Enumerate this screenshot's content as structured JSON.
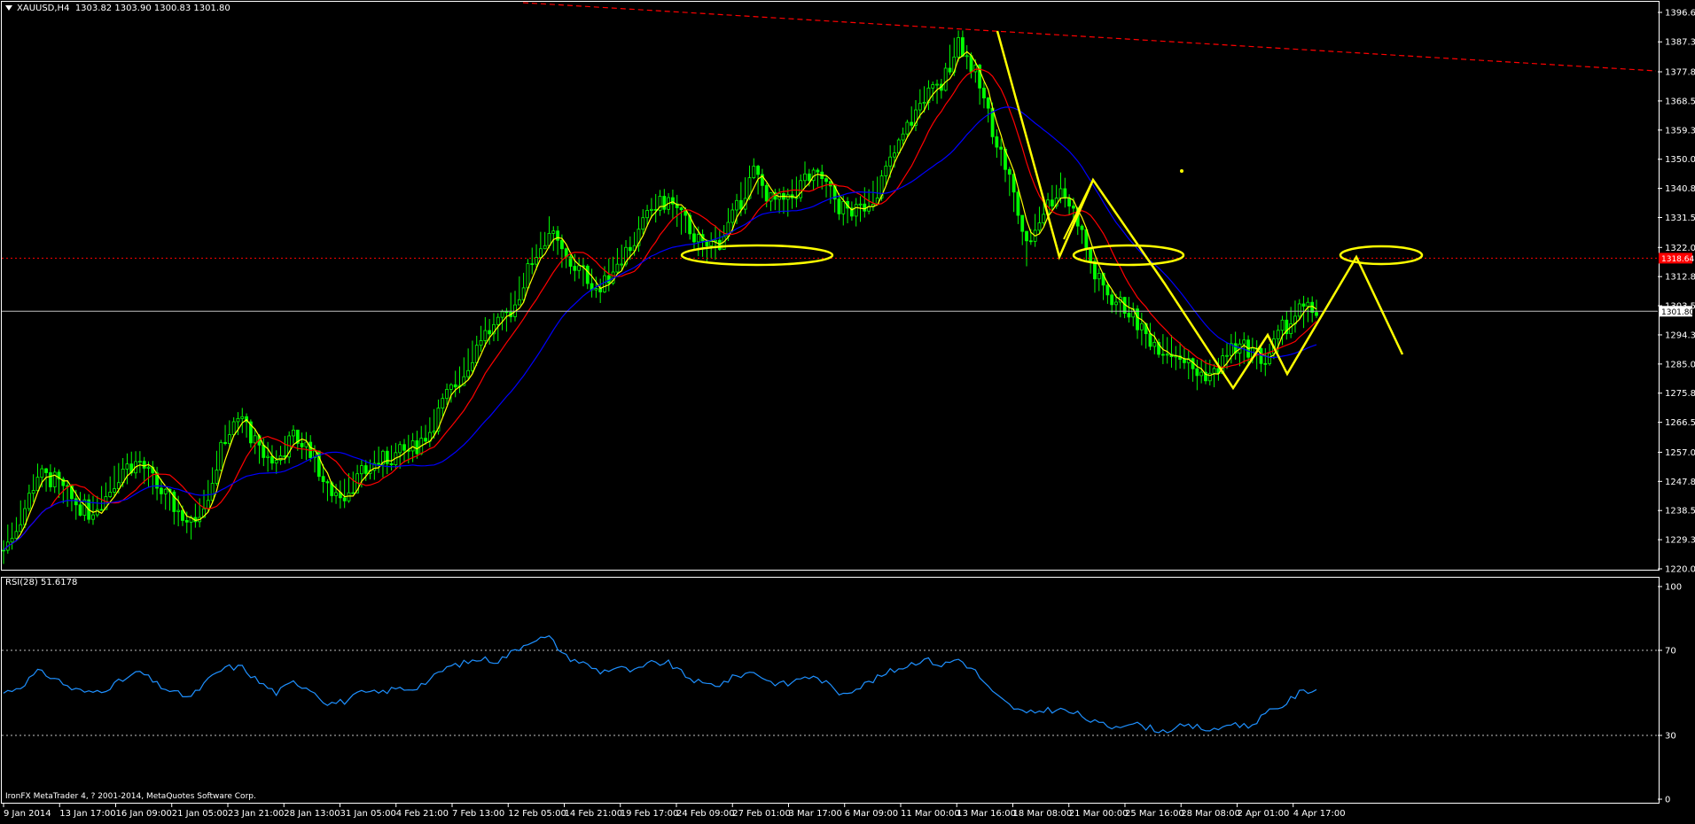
{
  "header": {
    "symbol": "XAUUSD,H4",
    "ohlc": "1303.82 1303.90 1300.83 1301.80"
  },
  "rsi_header": "RSI(28) 51.6178",
  "copyright": "IronFX MetaTrader 4, ? 2001-2014, MetaQuotes Software Corp.",
  "colors": {
    "background": "#000000",
    "candles": "#00ff00",
    "ma_fast": "#ffff00",
    "ma_mid": "#ff0000",
    "ma_slow": "#0000ff",
    "rsi_line": "#1e90ff",
    "annotation": "#ffff00",
    "resistance": "#ff0000",
    "current_price_line": "#c0c0c0"
  },
  "chart_data": [
    {
      "type": "line",
      "subtype": "candlestick",
      "symbol": "XAUUSD",
      "timeframe": "H4",
      "y_ticks": [
        "1396.65",
        "1387.30",
        "1377.80",
        "1368.55",
        "1359.30",
        "1350.05",
        "1340.80",
        "1331.55",
        "1322.05",
        "1312.80",
        "1303.55",
        "1294.30",
        "1285.05",
        "1275.80",
        "1266.55",
        "1257.05",
        "1247.80",
        "1238.55",
        "1229.30",
        "1220.05"
      ],
      "ylim": [
        1220.05,
        1396.65
      ],
      "x_ticks": [
        "9 Jan 2014",
        "13 Jan 17:00",
        "16 Jan 09:00",
        "21 Jan 05:00",
        "23 Jan 21:00",
        "28 Jan 13:00",
        "31 Jan 05:00",
        "4 Feb 21:00",
        "7 Feb 13:00",
        "12 Feb 05:00",
        "14 Feb 21:00",
        "19 Feb 17:00",
        "24 Feb 09:00",
        "27 Feb 01:00",
        "3 Mar 17:00",
        "6 Mar 09:00",
        "11 Mar 00:00",
        "13 Mar 16:00",
        "18 Mar 08:00",
        "21 Mar 00:00",
        "25 Mar 16:00",
        "28 Mar 08:00",
        "2 Apr 01:00",
        "4 Apr 17:00"
      ],
      "current_price": "1301.80",
      "red_level_label": "1318.64",
      "series": [
        {
          "name": "close",
          "x": [
            0,
            4,
            8,
            12,
            16,
            20,
            24,
            28,
            32,
            36,
            40,
            44,
            48,
            52,
            56,
            60,
            64,
            68,
            72,
            76,
            80,
            84,
            88,
            92,
            96,
            100,
            104,
            108,
            112,
            116,
            120,
            124,
            128,
            132,
            136,
            140,
            144,
            148,
            152,
            156,
            160,
            164,
            168,
            172,
            176,
            180,
            184,
            188,
            192,
            196,
            200,
            204,
            208,
            212,
            216,
            220,
            224,
            228,
            232,
            236,
            240,
            244,
            248,
            252,
            256,
            260,
            264,
            268,
            272,
            276,
            280,
            284,
            288,
            292,
            296,
            300,
            304,
            308
          ],
          "values": [
            1226,
            1236,
            1250,
            1248,
            1242,
            1238,
            1243,
            1252,
            1254,
            1246,
            1240,
            1234,
            1244,
            1262,
            1268,
            1257,
            1254,
            1262,
            1258,
            1245,
            1244,
            1250,
            1254,
            1256,
            1258,
            1264,
            1275,
            1282,
            1294,
            1297,
            1304,
            1318,
            1327,
            1318,
            1314,
            1308,
            1318,
            1324,
            1334,
            1337,
            1330,
            1322,
            1324,
            1334,
            1346,
            1337,
            1336,
            1344,
            1344,
            1335,
            1333,
            1338,
            1349,
            1360,
            1370,
            1373,
            1388,
            1377,
            1360,
            1344,
            1322,
            1334,
            1341,
            1331,
            1313,
            1306,
            1302,
            1294,
            1290,
            1288,
            1282,
            1282,
            1290,
            1290,
            1286,
            1296,
            1302,
            1302
          ]
        },
        {
          "name": "high",
          "x": [
            0,
            4,
            8,
            12,
            16,
            20,
            24,
            28,
            32,
            36,
            40,
            44,
            48,
            52,
            56,
            60,
            64,
            68,
            72,
            76,
            80,
            84,
            88,
            92,
            96,
            100,
            104,
            108,
            112,
            116,
            120,
            124,
            128,
            132,
            136,
            140,
            144,
            148,
            152,
            156,
            160,
            164,
            168,
            172,
            176,
            180,
            184,
            188,
            192,
            196,
            200,
            204,
            208,
            212,
            216,
            220,
            224,
            228,
            232,
            236,
            240,
            244,
            248,
            252,
            256,
            260,
            264,
            268,
            272,
            276,
            280,
            284,
            288,
            292,
            296,
            300,
            304,
            308
          ],
          "values": [
            1230,
            1240,
            1254,
            1252,
            1246,
            1242,
            1247,
            1256,
            1258,
            1250,
            1244,
            1238,
            1248,
            1266,
            1272,
            1261,
            1258,
            1266,
            1262,
            1249,
            1248,
            1254,
            1258,
            1260,
            1262,
            1268,
            1279,
            1286,
            1298,
            1301,
            1308,
            1322,
            1331,
            1322,
            1318,
            1312,
            1322,
            1328,
            1338,
            1341,
            1334,
            1326,
            1328,
            1338,
            1350,
            1341,
            1340,
            1348,
            1348,
            1339,
            1337,
            1342,
            1353,
            1364,
            1374,
            1377,
            1392,
            1381,
            1364,
            1348,
            1326,
            1338,
            1345,
            1335,
            1317,
            1310,
            1306,
            1298,
            1294,
            1292,
            1286,
            1286,
            1294,
            1294,
            1290,
            1300,
            1306,
            1306
          ]
        },
        {
          "name": "low",
          "x": [
            0,
            4,
            8,
            12,
            16,
            20,
            24,
            28,
            32,
            36,
            40,
            44,
            48,
            52,
            56,
            60,
            64,
            68,
            72,
            76,
            80,
            84,
            88,
            92,
            96,
            100,
            104,
            108,
            112,
            116,
            120,
            124,
            128,
            132,
            136,
            140,
            144,
            148,
            152,
            156,
            160,
            164,
            168,
            172,
            176,
            180,
            184,
            188,
            192,
            196,
            200,
            204,
            208,
            212,
            216,
            220,
            224,
            228,
            232,
            236,
            240,
            244,
            248,
            252,
            256,
            260,
            264,
            268,
            272,
            276,
            280,
            284,
            288,
            292,
            296,
            300,
            304,
            308
          ],
          "values": [
            1222,
            1232,
            1246,
            1244,
            1238,
            1234,
            1239,
            1248,
            1250,
            1242,
            1236,
            1230,
            1240,
            1258,
            1264,
            1253,
            1250,
            1258,
            1254,
            1241,
            1240,
            1246,
            1250,
            1252,
            1254,
            1260,
            1271,
            1278,
            1290,
            1293,
            1300,
            1314,
            1323,
            1314,
            1310,
            1304,
            1314,
            1320,
            1330,
            1333,
            1326,
            1318,
            1320,
            1330,
            1342,
            1333,
            1332,
            1340,
            1340,
            1331,
            1329,
            1334,
            1345,
            1356,
            1366,
            1369,
            1384,
            1373,
            1356,
            1340,
            1318,
            1330,
            1337,
            1327,
            1309,
            1302,
            1298,
            1290,
            1286,
            1284,
            1278,
            1278,
            1286,
            1286,
            1282,
            1292,
            1298,
            1298
          ]
        }
      ]
    },
    {
      "type": "line",
      "title": "RSI(28) 51.6178",
      "ylim": [
        0,
        100
      ],
      "y_ticks": [
        "100",
        "70",
        "30",
        "0"
      ],
      "levels": [
        70,
        30
      ],
      "x": [
        0,
        4,
        8,
        12,
        16,
        20,
        24,
        28,
        32,
        36,
        40,
        44,
        48,
        52,
        56,
        60,
        64,
        68,
        72,
        76,
        80,
        84,
        88,
        92,
        96,
        100,
        104,
        108,
        112,
        116,
        120,
        124,
        128,
        132,
        136,
        140,
        144,
        148,
        152,
        156,
        160,
        164,
        168,
        172,
        176,
        180,
        184,
        188,
        192,
        196,
        200,
        204,
        208,
        212,
        216,
        220,
        224,
        228,
        232,
        236,
        240,
        244,
        248,
        252,
        256,
        260,
        264,
        268,
        272,
        276,
        280,
        284,
        288,
        292,
        296,
        300,
        304,
        308
      ],
      "values": [
        50,
        53,
        60,
        57,
        52,
        50,
        52,
        56,
        60,
        54,
        50,
        48,
        56,
        62,
        62,
        55,
        50,
        55,
        52,
        45,
        46,
        50,
        50,
        52,
        52,
        56,
        62,
        64,
        66,
        65,
        70,
        75,
        76,
        67,
        64,
        60,
        62,
        60,
        64,
        64,
        58,
        54,
        54,
        58,
        60,
        55,
        54,
        58,
        56,
        50,
        52,
        56,
        60,
        63,
        66,
        63,
        66,
        60,
        50,
        44,
        40,
        42,
        42,
        40,
        36,
        34,
        36,
        34,
        32,
        34,
        34,
        32,
        36,
        34,
        40,
        44,
        50,
        52
      ]
    }
  ]
}
